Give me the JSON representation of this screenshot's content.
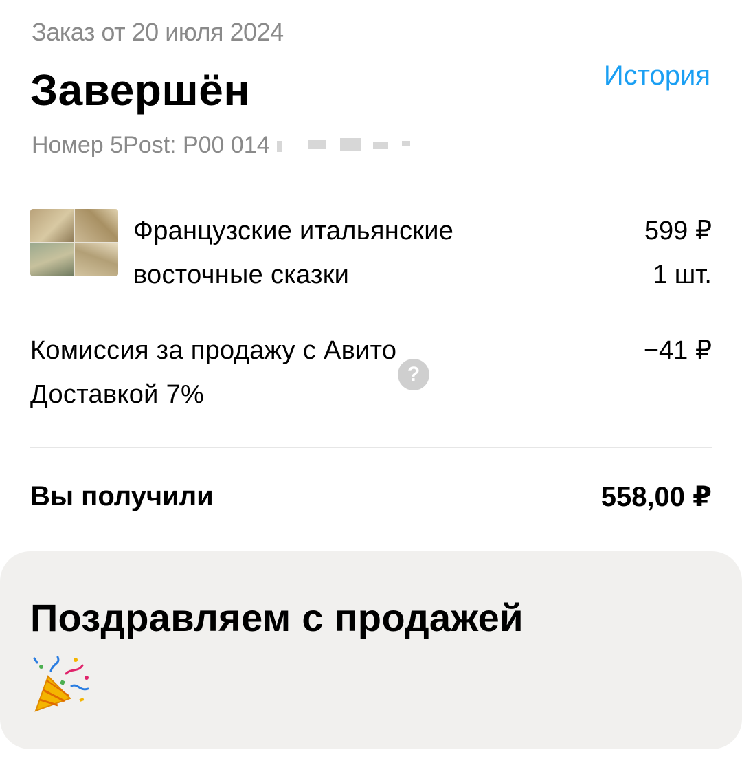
{
  "order": {
    "date_text": "Заказ от 20 июля 2024",
    "status": "Завершён",
    "history_link": "История",
    "tracking_text": "Номер 5Post: P00 014"
  },
  "item": {
    "title": "Французские итальянские восточные сказки",
    "price": "599 ₽",
    "quantity": "1 шт."
  },
  "fee": {
    "label": "Комиссия за продажу с Авито Доставкой 7%",
    "amount": "−41 ₽",
    "help_symbol": "?"
  },
  "total": {
    "label": "Вы получили",
    "amount": "558,00 ₽"
  },
  "congrats": {
    "title": "Поздравляем с продажей",
    "icon": "party-popper-icon"
  },
  "colors": {
    "accent": "#1a9ff3",
    "muted_text": "#8a8a8a",
    "card_background": "#f1f0ee"
  }
}
